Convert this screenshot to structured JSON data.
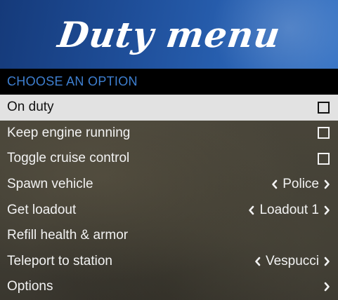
{
  "banner": {
    "title": "Duty menu"
  },
  "subheader": {
    "text": "CHOOSE AN OPTION"
  },
  "items": [
    {
      "label": "On duty",
      "type": "checkbox",
      "checked": false,
      "selected": true
    },
    {
      "label": "Keep engine running",
      "type": "checkbox",
      "checked": false
    },
    {
      "label": "Toggle cruise control",
      "type": "checkbox",
      "checked": false
    },
    {
      "label": "Spawn vehicle",
      "type": "list",
      "value": "Police"
    },
    {
      "label": "Get loadout",
      "type": "list",
      "value": "Loadout 1"
    },
    {
      "label": "Refill health & armor",
      "type": "button"
    },
    {
      "label": "Teleport to station",
      "type": "list",
      "value": "Vespucci"
    },
    {
      "label": "Options",
      "type": "submenu"
    }
  ],
  "icons": {
    "left": "chevron-left-icon",
    "right": "chevron-right-icon"
  },
  "colors": {
    "banner": "#2a64b6",
    "subheader_text": "#3e7fd0",
    "selected_bg": "#e2e2e2"
  }
}
